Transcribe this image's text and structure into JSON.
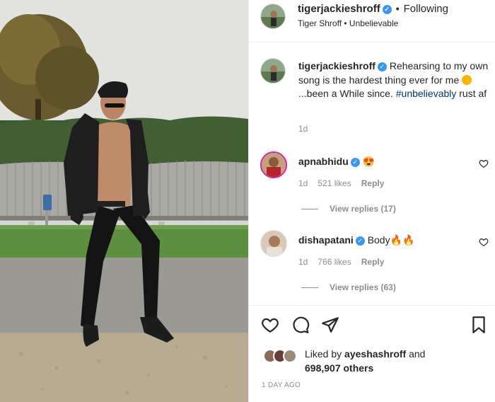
{
  "header": {
    "username": "tigerjackieshroff",
    "verified_icon": "verified-badge-icon",
    "separator": "•",
    "follow_status": "Following",
    "audio": "Tiger Shroff • Unbelievable"
  },
  "caption": {
    "username": "tigerjackieshroff",
    "text_part1": "Rehearsing to my own song is the hardest thing ever for me",
    "text_part2": "...been a While since.",
    "hashtag": "#unbelievably",
    "text_part3": "rust af",
    "time": "1d"
  },
  "comments": [
    {
      "username": "apnabhidu",
      "text": "😍",
      "time": "1d",
      "likes": "521 likes",
      "reply_label": "Reply",
      "view_replies": "View replies (17)"
    },
    {
      "username": "dishapatani",
      "text": "Body🔥🔥",
      "time": "1d",
      "likes": "766 likes",
      "reply_label": "Reply",
      "view_replies": "View replies (63)"
    }
  ],
  "actions": {
    "icons": [
      "heart-icon",
      "comment-icon",
      "share-icon",
      "bookmark-icon"
    ]
  },
  "likes": {
    "prefix": "Liked by",
    "user": "ayeshashroff",
    "conj": "and",
    "others": "698,907 others"
  },
  "post_age": "1 DAY AGO",
  "colors": {
    "link": "#00376b",
    "verified": "#3897f0",
    "muted": "#8e8e8e",
    "text": "#262626"
  }
}
